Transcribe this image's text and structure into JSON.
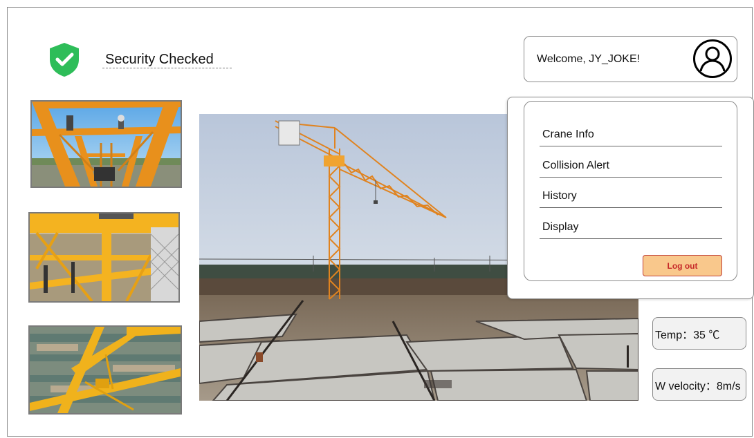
{
  "security": {
    "label": "Security Checked",
    "icon": "shield-check-icon",
    "color": "#2ebd59"
  },
  "user": {
    "welcome": "Welcome, JY_JOKE!",
    "avatar_icon": "user-avatar-icon"
  },
  "menu": {
    "items": [
      {
        "label": "Crane Info"
      },
      {
        "label": "Collision Alert"
      },
      {
        "label": "History"
      },
      {
        "label": "Display"
      }
    ],
    "logout_label": "Log out"
  },
  "stats": {
    "temp": "Temp：35 ℃",
    "wind": "W velocity：8m/s"
  },
  "colors": {
    "accent_button": "#f9c88c",
    "button_text": "#c62828",
    "crane_yellow": "#f2a626"
  }
}
